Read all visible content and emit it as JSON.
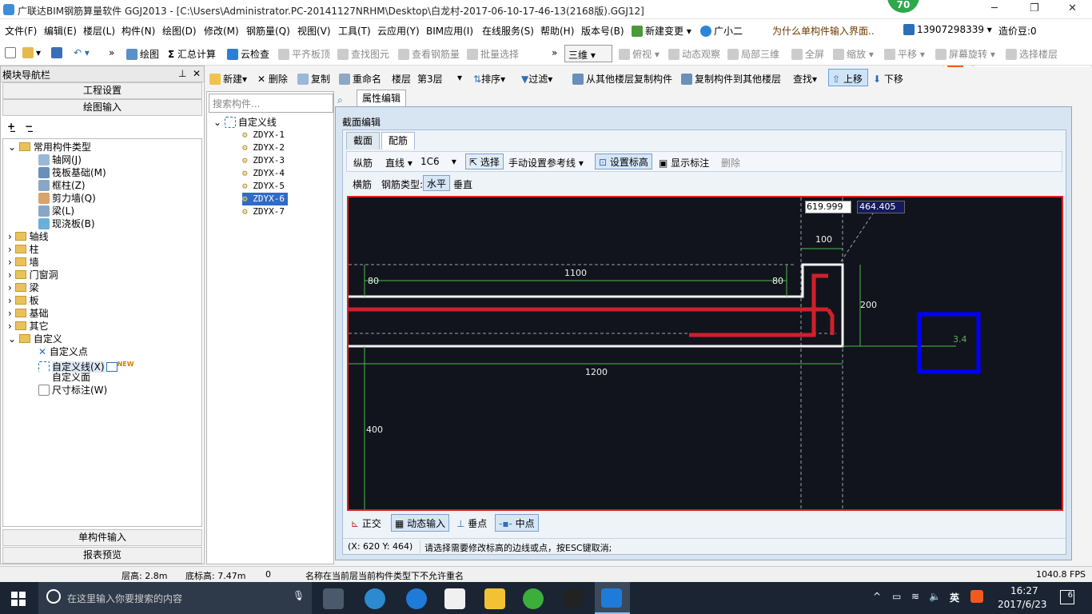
{
  "title": {
    "text": "广联达BIM钢筋算量软件 GGJ2013 - [C:\\Users\\Administrator.PC-20141127NRHM\\Desktop\\白龙村-2017-06-10-17-46-13(2168版).GGJ12]",
    "badge": "70"
  },
  "menu": [
    "文件(F)",
    "编辑(E)",
    "楼层(L)",
    "构件(N)",
    "绘图(D)",
    "修改(M)",
    "钢筋量(Q)",
    "视图(V)",
    "工具(T)",
    "云应用(Y)",
    "BIM应用(I)",
    "在线服务(S)",
    "帮助(H)",
    "版本号(B)",
    "新建变更",
    "广小二",
    "为什么单构件输入界面..",
    "13907298339",
    "造价豆:0"
  ],
  "toolbar1": [
    "绘图",
    "汇总计算",
    "云检查",
    "平齐板顶",
    "查找图元",
    "查看钢筋量",
    "批量选择",
    "三维",
    "俯视",
    "动态观察",
    "局部三维",
    "全屏",
    "缩放",
    "平移",
    "屏幕旋转",
    "选择楼层"
  ],
  "left": {
    "header": "模块导航栏",
    "btn_project": "工程设置",
    "btn_draw": "绘图输入",
    "tree": {
      "common": "常用构件类型",
      "common_items": [
        "轴网(J)",
        "筏板基础(M)",
        "框柱(Z)",
        "剪力墙(Q)",
        "梁(L)",
        "现浇板(B)"
      ],
      "groups": [
        "轴线",
        "柱",
        "墙",
        "门窗洞",
        "梁",
        "板",
        "基础",
        "其它"
      ],
      "custom": "自定义",
      "custom_items": [
        "自定义点",
        "自定义线(X)",
        "自定义面",
        "尺寸标注(W)"
      ],
      "new_badge": "NEW"
    },
    "btn_single": "单构件输入",
    "btn_report": "报表预览"
  },
  "toolbar2": [
    "新建",
    "删除",
    "复制",
    "重命名",
    "楼层",
    "第3层",
    "排序",
    "过滤",
    "从其他楼层复制构件",
    "复制构件到其他楼层",
    "查找",
    "上移",
    "下移"
  ],
  "mid": {
    "search_placeholder": "搜索构件...",
    "root": "自定义线",
    "items": [
      "ZDYX-1",
      "ZDYX-2",
      "ZDYX-3",
      "ZDYX-4",
      "ZDYX-5",
      "ZDYX-6",
      "ZDYX-7"
    ],
    "selected_index": 5
  },
  "props_tab": "属性编辑",
  "dialog": {
    "title": "截面编辑",
    "tabs": [
      "截面",
      "配筋"
    ],
    "row1": [
      "纵筋",
      "直线",
      "1C6",
      "选择",
      "手动设置参考线",
      "设置标高",
      "显示标注",
      "删除"
    ],
    "row2": [
      "横筋",
      "钢筋类型:",
      "水平",
      "垂直"
    ],
    "input_x": "619.999",
    "input_y": "464.405",
    "dims": {
      "d100": "100",
      "d1100": "1100",
      "d80a": "80",
      "d80b": "80",
      "d200": "200",
      "d1200": "1200",
      "d400": "400",
      "d34": "3.4"
    },
    "bottom": [
      "正交",
      "动态输入",
      "垂点",
      "中点"
    ],
    "coords": "(X: 620 Y: 464)",
    "status": "请选择需要修改标高的边线或点，按ESC键取消;"
  },
  "statusbar": {
    "floor_h": "层高: 2.8m",
    "bottom_h": "底标高: 7.47m",
    "zero": "0",
    "msg": "名称在当前层当前构件类型下不允许重名",
    "fps": "1040.8 FPS"
  },
  "taskbar": {
    "search": "在这里输入你要搜索的内容",
    "ime": "英",
    "time": "16:27",
    "date": "2017/6/23",
    "notif": "6"
  },
  "colors": {
    "accent": "#e02020",
    "canvas": "#12141d",
    "rebar": "#d0202a",
    "dim": "#4fb84f",
    "select": "#0000ff"
  }
}
